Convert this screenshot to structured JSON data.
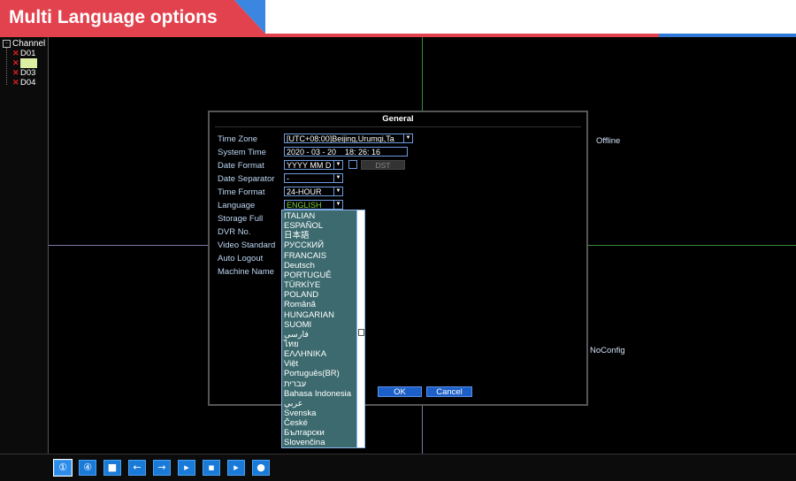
{
  "banner": {
    "title": "Multi Language options",
    "accent_red": "#e2424e",
    "accent_blue": "#2e78d8"
  },
  "sidebar": {
    "header": "Channel",
    "channels": [
      {
        "label": "D01",
        "selected": false
      },
      {
        "label": "D02",
        "selected": true
      },
      {
        "label": "D03",
        "selected": false
      },
      {
        "label": "D04",
        "selected": false
      }
    ]
  },
  "status": {
    "offline": "Offline",
    "noconfig": "NoConfig"
  },
  "dialog": {
    "title": "General",
    "fields": {
      "time_zone": {
        "label": "Time Zone",
        "value": "[UTC+08:00]Beijing,Urumqi,Ta"
      },
      "system_time": {
        "label": "System Time",
        "date": "2020 - 03 - 20",
        "time": "18: 26: 16"
      },
      "date_format": {
        "label": "Date Format",
        "value": "YYYY MM D",
        "dst": "DST"
      },
      "date_separator": {
        "label": "Date Separator",
        "value": "-"
      },
      "time_format": {
        "label": "Time Format",
        "value": "24-HOUR"
      },
      "language": {
        "label": "Language",
        "value": "ENGLISH"
      },
      "storage_full": {
        "label": "Storage Full"
      },
      "dvr_no": {
        "label": "DVR No."
      },
      "video_standard": {
        "label": "Video Standard"
      },
      "auto_logout": {
        "label": "Auto Logout"
      },
      "machine_name": {
        "label": "Machine Name"
      }
    },
    "ok_label": "OK",
    "cancel_label": "Cancel"
  },
  "language_options": [
    "ITALIAN",
    "ESPAÑOL",
    "日本語",
    "РУССКИЙ",
    "FRANCAIS",
    "Deutsch",
    "PORTUGUÊ",
    "TÜRKİYE",
    "POLAND",
    "Românã",
    "HUNGARIAN",
    "SUOMI",
    "فارسی",
    "ไทย",
    "ΕΛΛΗΝΙΚΑ",
    "Việt",
    "Português(BR)",
    "עברית",
    "Bahasa Indonesia",
    "عربي",
    "Svenska",
    "České",
    "Български",
    "Slovenčina"
  ],
  "toolbar": {
    "buttons": [
      {
        "name": "view-1-button",
        "glyph": "①"
      },
      {
        "name": "view-4-button",
        "glyph": "④"
      },
      {
        "name": "fullscreen-button",
        "glyph": "■"
      },
      {
        "name": "prev-button",
        "glyph": "←"
      },
      {
        "name": "next-button",
        "glyph": "→"
      },
      {
        "name": "play-button",
        "glyph": "▸"
      },
      {
        "name": "record-button",
        "glyph": "▪"
      },
      {
        "name": "playback-button",
        "glyph": "▸"
      },
      {
        "name": "settings-button",
        "glyph": "●"
      }
    ]
  }
}
